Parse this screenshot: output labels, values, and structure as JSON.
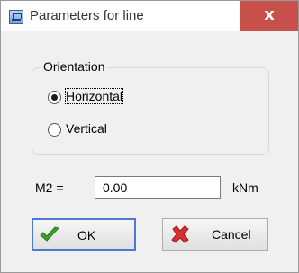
{
  "window": {
    "title": "Parameters for line",
    "close_glyph": "x",
    "icon": "parameters-icon"
  },
  "orientation": {
    "legend": "Orientation",
    "options": [
      {
        "label": "Horizontal",
        "selected": true
      },
      {
        "label": "Vertical",
        "selected": false
      }
    ]
  },
  "m2": {
    "label": "M2 =",
    "value": "0.00",
    "unit": "kNm"
  },
  "buttons": {
    "ok": {
      "label": "OK",
      "icon": "checkmark-icon",
      "color": "#3aa02a"
    },
    "cancel": {
      "label": "Cancel",
      "icon": "red-x-icon",
      "color": "#d83030"
    }
  }
}
